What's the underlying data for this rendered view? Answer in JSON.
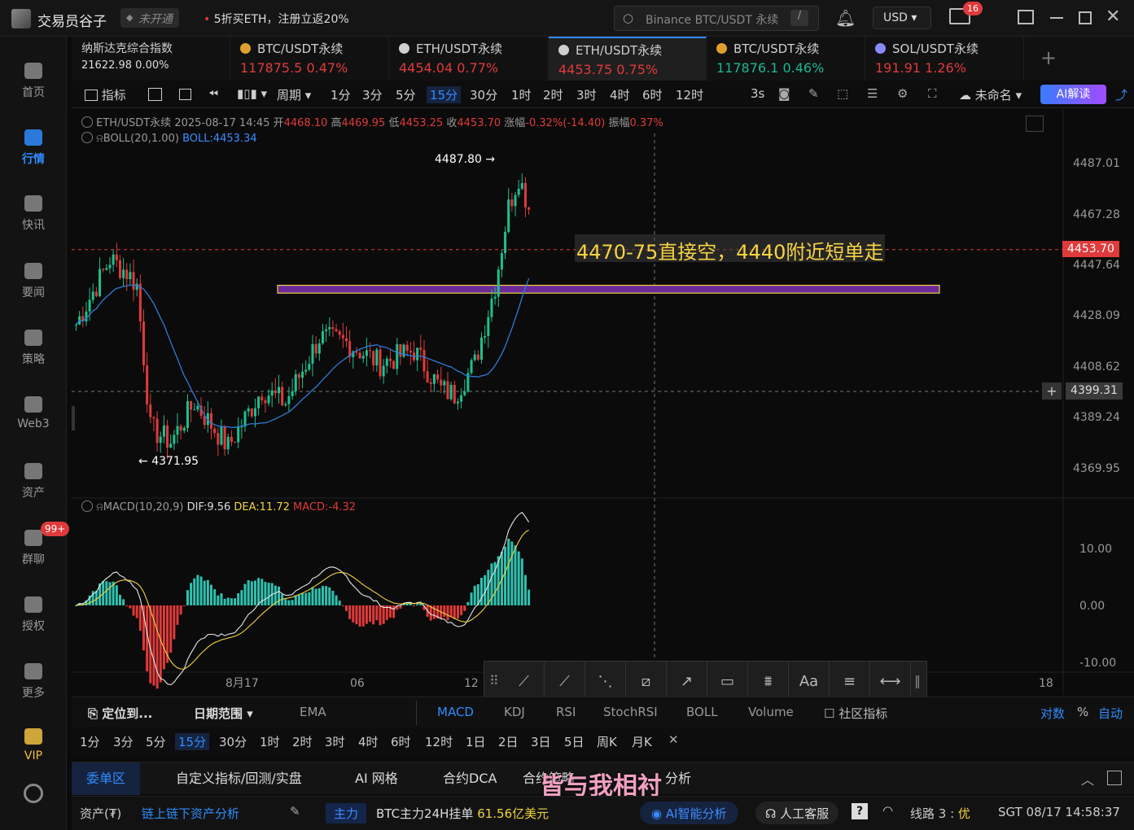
{
  "titlebar": {
    "app_name": "交易员谷子",
    "badge": "未开通",
    "promo": "5折买ETH，注册立返20%",
    "search_placeholder": "Binance BTC/USDT 永续",
    "search_hotkey": "/",
    "currency": "USD",
    "mail_count": "16"
  },
  "sidebar": [
    {
      "label": "首页",
      "icon": "home-icon"
    },
    {
      "label": "行情",
      "icon": "chart-bar-icon",
      "active": true
    },
    {
      "label": "快讯",
      "icon": "news-icon"
    },
    {
      "label": "要闻",
      "icon": "document-icon"
    },
    {
      "label": "策略",
      "icon": "robot-icon"
    },
    {
      "label": "Web3",
      "icon": "web3-icon"
    },
    {
      "label": "资产",
      "icon": "wallet-icon"
    },
    {
      "label": "群聊",
      "icon": "chat-icon",
      "badge": "99+"
    },
    {
      "label": "授权",
      "icon": "key-icon"
    },
    {
      "label": "更多",
      "icon": "grid-icon"
    },
    {
      "label": "VIP",
      "icon": "diamond-icon"
    }
  ],
  "tickers": [
    {
      "name": "纳斯达克综合指数",
      "price": "21622.98",
      "change": "0.00%",
      "dir": "flat"
    },
    {
      "name": "BTC/USDT永续",
      "price": "117875.5",
      "change": "0.47%",
      "dir": "up"
    },
    {
      "name": "ETH/USDT永续",
      "price": "4454.04",
      "change": "0.77%",
      "dir": "up"
    },
    {
      "name": "ETH/USDT永续",
      "price": "4453.75",
      "change": "0.75%",
      "dir": "up",
      "active": true
    },
    {
      "name": "BTC/USDT永续",
      "price": "117876.1",
      "change": "0.46%",
      "dir": "dn"
    },
    {
      "name": "SOL/USDT永续",
      "price": "191.91",
      "change": "1.26%",
      "dir": "up"
    }
  ],
  "toolbar": {
    "indicators": "指标",
    "period": "周期",
    "intervals": [
      "1分",
      "3分",
      "5分",
      "15分",
      "30分",
      "1时",
      "2时",
      "3时",
      "4时",
      "6时",
      "12时"
    ],
    "active_interval": "15分",
    "refresh": "3s",
    "layout_name": "未命名",
    "ai_button": "AI解读"
  },
  "chart_header": {
    "symbol": "ETH/USDT永续",
    "datetime": "2025-08-17 14:45",
    "open_label": "开",
    "open": "4468.10",
    "high_label": "高",
    "high": "4469.95",
    "low_label": "低",
    "low": "4453.25",
    "close_label": "收",
    "close": "4453.70",
    "chg_label": "涨幅",
    "chg": "-0.32%(-14.40)",
    "amp_label": "振幅",
    "amp": "0.37%",
    "boll_label": "BOLL(20,1.00)",
    "boll_value": "BOLL:4453.34"
  },
  "chart_data": {
    "type": "candlestick",
    "y_ticks": [
      "4487.01",
      "4467.28",
      "4447.64",
      "4428.09",
      "4408.62",
      "4389.24",
      "4369.95"
    ],
    "y_range": [
      4360,
      4495
    ],
    "x_labels": [
      "8月17",
      "06",
      "12",
      "18"
    ],
    "last_price": "4453.70",
    "crosshair_price": "4399.31",
    "high_marker": "4487.80",
    "low_marker": "4371.95",
    "annotation": "4470-75直接空，4440附近短单走",
    "zone": [
      4437,
      4440
    ]
  },
  "macd": {
    "label": "MACD(10,20,9)",
    "dif": "DIF:9.56",
    "dea": "DEA:11.72",
    "macd": "MACD:-4.32",
    "y_ticks": [
      "10.00",
      "0.00",
      "-10.00"
    ]
  },
  "drawing_tools": [
    "cross-tool",
    "line-tool",
    "fib-tool",
    "channel-tool",
    "ray-tool",
    "rect-tool",
    "ruler-tool",
    "text-tool",
    "parallel-tool",
    "range-tool"
  ],
  "bottom1": {
    "locate": "定位到...",
    "range": "日期范围",
    "ema": "EMA",
    "tabs": [
      "MACD",
      "KDJ",
      "RSI",
      "StochRSI",
      "BOLL",
      "Volume"
    ],
    "active_tab": "MACD",
    "community": "社区指标",
    "log": "对数",
    "pct": "%",
    "auto": "自动"
  },
  "bottom2": {
    "intervals": [
      "1分",
      "3分",
      "5分",
      "15分",
      "30分",
      "1时",
      "2时",
      "3时",
      "4时",
      "6时",
      "12时",
      "1日",
      "2日",
      "3日",
      "5日",
      "周K",
      "月K"
    ],
    "active": "15分"
  },
  "bottom3": {
    "tabs": [
      "委单区",
      "自定义指标/回测/实盘",
      "AI 网格",
      "合约DCA",
      "合约策略",
      "分析"
    ],
    "active": "委单区",
    "watermark": "皆与我相衬"
  },
  "status": {
    "assets": "资产(₮)",
    "onchain": "链上链下资产分析",
    "main_tag": "主力",
    "main_text": "BTC主力24H挂单",
    "main_value": "61.56亿美元",
    "ai": "AI智能分析",
    "cs": "人工客服",
    "line": "线路 3 :",
    "line_q": "优",
    "time": "SGT 08/17 14:58:37"
  }
}
